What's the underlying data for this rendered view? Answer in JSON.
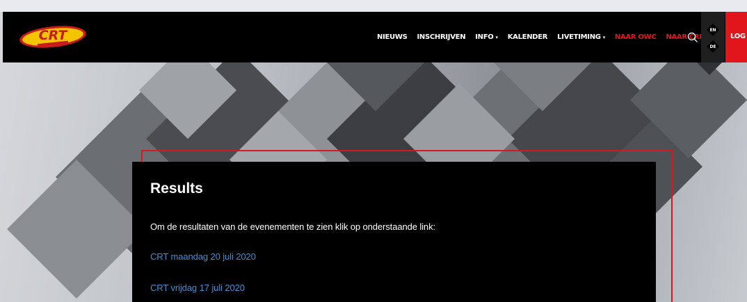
{
  "header": {
    "logo_text": "CRT",
    "logo_subtext": "club racetoernooien",
    "nav": [
      {
        "label": "NIEUWS",
        "dropdown": false,
        "color": "#ffffff"
      },
      {
        "label": "INSCHRIJVEN",
        "dropdown": false,
        "color": "#ffffff"
      },
      {
        "label": "INFO",
        "dropdown": true,
        "color": "#ffffff"
      },
      {
        "label": "KALENDER",
        "dropdown": false,
        "color": "#ffffff"
      },
      {
        "label": "LIVETIMING",
        "dropdown": true,
        "color": "#ffffff"
      },
      {
        "label": "NAAR OWC",
        "dropdown": false,
        "color": "#e0161c"
      },
      {
        "label": "NAAR CRE",
        "dropdown": false,
        "color": "#e0161c"
      }
    ],
    "caret": "▾",
    "languages": [
      "EN",
      "DE"
    ],
    "login_label": "LOG IN"
  },
  "content": {
    "title": "Results",
    "intro": "Om de resultaten van de evenementen te zien klik op onderstaande link:",
    "links": [
      "CRT maandag 20 juli 2020",
      "CRT vrijdag 17 juli 2020"
    ]
  },
  "colors": {
    "accent_red": "#e0161c",
    "link_blue": "#3d8fd6",
    "navbar_bg": "#000000"
  }
}
